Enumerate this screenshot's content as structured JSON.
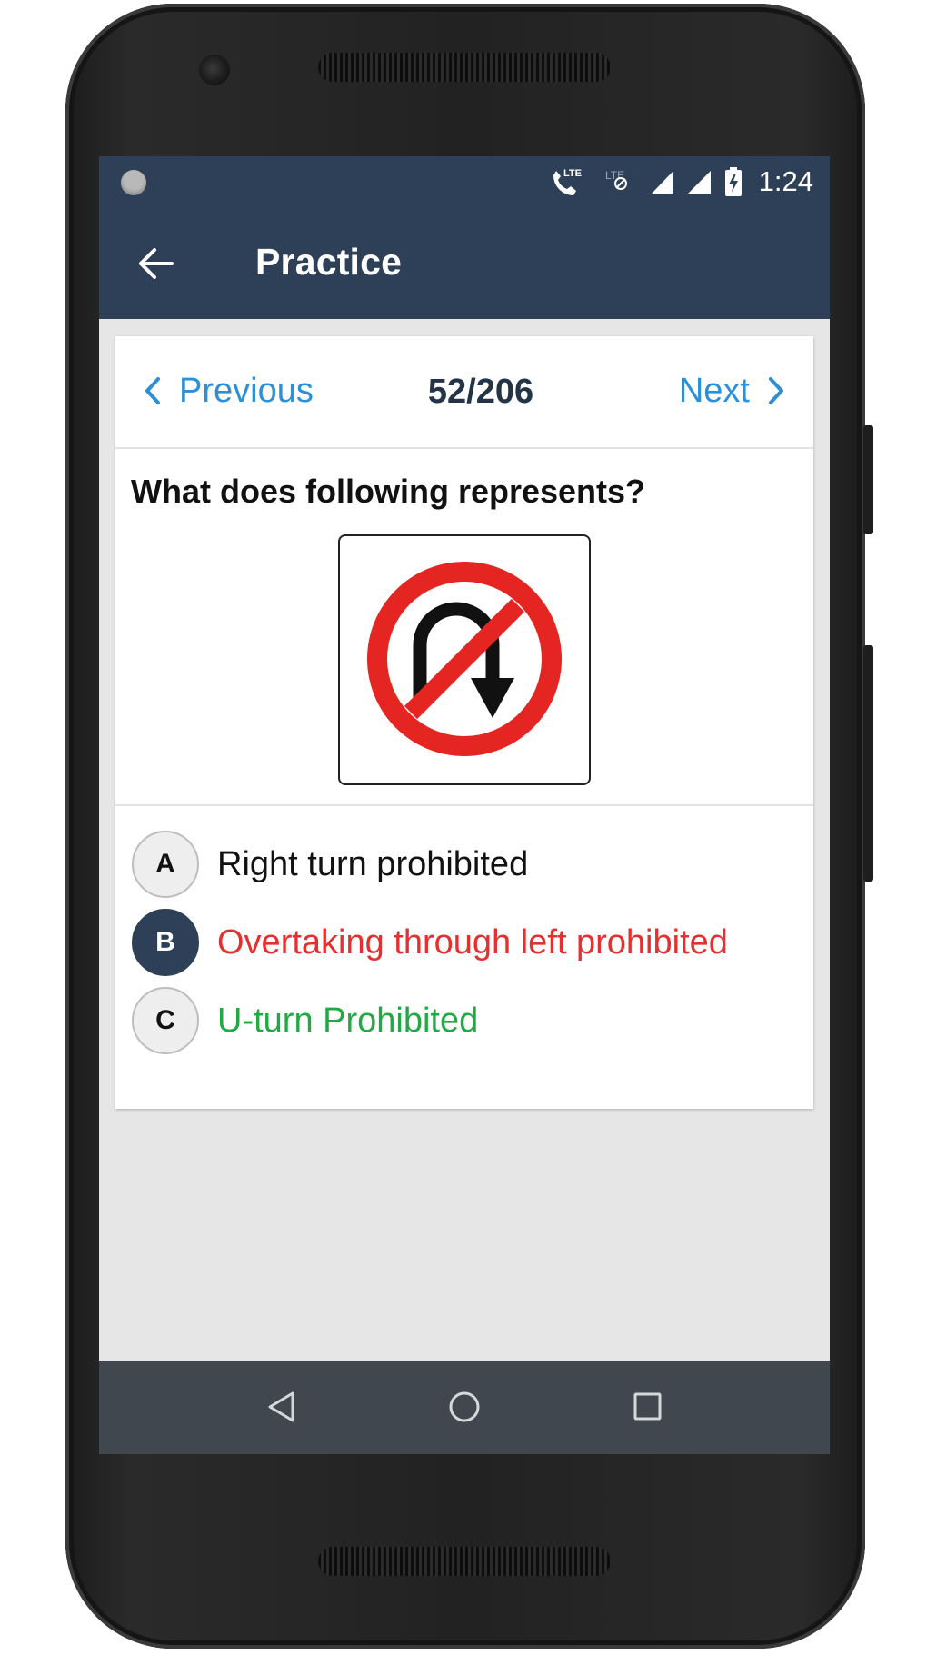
{
  "status_bar": {
    "time": "1:24",
    "icons": [
      "notification-dot-icon",
      "lte-call-icon",
      "lte-data-icon",
      "signal-icon",
      "signal-icon",
      "battery-charging-icon"
    ],
    "lte_label": "LTE"
  },
  "app_bar": {
    "title": "Practice",
    "back_icon": "arrow-left-icon"
  },
  "question_nav": {
    "previous_label": "Previous",
    "next_label": "Next",
    "counter": "52/206"
  },
  "question": {
    "text": "What does following represents?",
    "image_icon": "no-u-turn-sign-icon"
  },
  "options": [
    {
      "letter": "A",
      "text": "Right turn prohibited",
      "state": "unselected",
      "text_color": "#111111"
    },
    {
      "letter": "B",
      "text": "Overtaking through left prohibited",
      "state": "selected-wrong",
      "text_color": "#e53030"
    },
    {
      "letter": "C",
      "text": "U-turn Prohibited",
      "state": "correct",
      "text_color": "#22a845"
    }
  ],
  "system_nav": {
    "icons": [
      "back-triangle-icon",
      "home-circle-icon",
      "recents-square-icon"
    ]
  },
  "colors": {
    "primary": "#2e4057",
    "link": "#2d8fd6",
    "wrong": "#e53030",
    "correct": "#22a845",
    "background": "#e6e6e6"
  }
}
